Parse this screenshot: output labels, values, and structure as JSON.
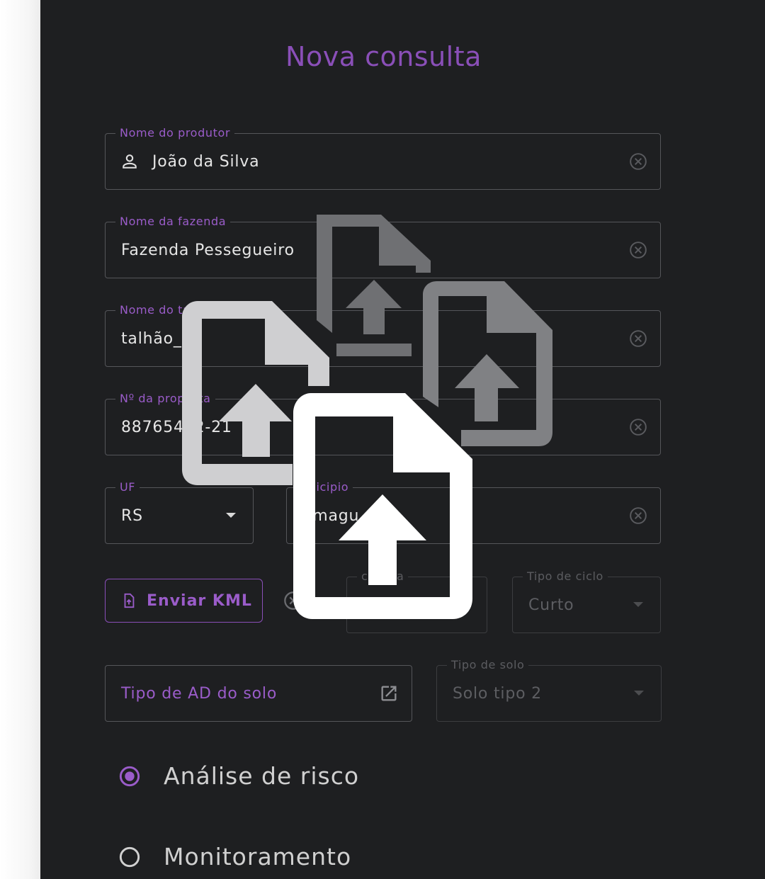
{
  "title": "Nova consulta",
  "fields": {
    "produtor": {
      "label": "Nome do produtor",
      "value": "João da Silva"
    },
    "fazenda": {
      "label": "Nome da fazenda",
      "value": "Fazenda Pessegueiro"
    },
    "talhao": {
      "label": "Nome do talhão",
      "value": "talhão_01"
    },
    "proposta": {
      "label": "Nº da proposta",
      "value": "88765432-21"
    },
    "uf": {
      "label": "UF",
      "value": "RS"
    },
    "municipio": {
      "label": "unicipio",
      "value": "amagu"
    },
    "cultura": {
      "label": "cultura"
    },
    "ciclo": {
      "label": "Tipo de ciclo",
      "value": "Curto"
    },
    "solo": {
      "label": "Tipo de solo",
      "value": "Solo tipo 2"
    }
  },
  "buttons": {
    "kml": "Enviar KML",
    "ad_solo": "Tipo de AD do solo"
  },
  "radios": [
    {
      "label": "Análise de risco",
      "selected": true
    },
    {
      "label": "Monitoramento",
      "selected": false
    }
  ],
  "colors": {
    "accent": "#8a4fb8",
    "background": "#1e1f21",
    "border": "#55565a"
  },
  "icons": {
    "person": "person-icon",
    "clear": "clear-circle-icon",
    "upload_file": "file-upload-icon",
    "open_external": "open-in-new-icon"
  }
}
